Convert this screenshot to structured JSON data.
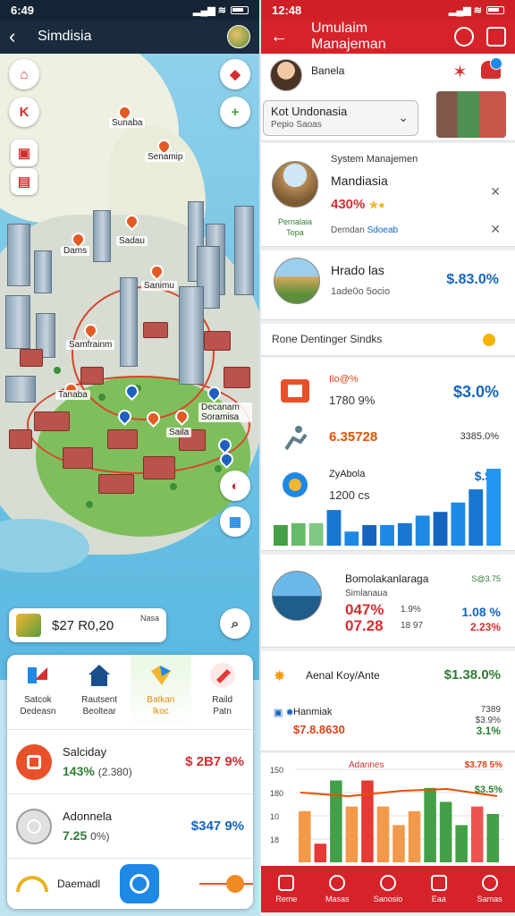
{
  "left": {
    "status_time": "6:49",
    "title": "Simdisia",
    "map_labels": [
      "Sunaba",
      "Senamip",
      "Sadau",
      "Dams",
      "Sanimu",
      "Samfrainm",
      "Tanaba",
      "Decanam Soramisa",
      "Saila"
    ],
    "price_chip": {
      "value": "$27 R0,20",
      "sub": "Nasa"
    },
    "quick": [
      {
        "label": "Satcok\nDedeasn"
      },
      {
        "label": "Rautsent\nBeoltear"
      },
      {
        "label": "Batkan\nlkoc"
      },
      {
        "label": "Raild\nPatn"
      }
    ],
    "stats": [
      {
        "name": "Salciday",
        "pct": "143%",
        "sub": "(2.380)",
        "value": "$ 2B7 9%"
      },
      {
        "name": "Adonnela",
        "pct": "7.25",
        "sub": "0%)",
        "value": "$347 9%"
      }
    ],
    "bottom_label": "Daemadl"
  },
  "right": {
    "status_time": "12:48",
    "title": "Umulaim Manajeman",
    "profile_name": "Banela",
    "select_main": "Kot Undonasia",
    "select_sub": "Pepio Saoas",
    "system": {
      "title": "System Manajemen",
      "name": "Mandiasia",
      "value": "430%",
      "caption": "Pernalaia\nTopa",
      "foot": "Demdan",
      "foot2": "Sdoeab"
    },
    "hrado": {
      "name": "Hrado las",
      "sub": "1ade0o 5ocio",
      "value": "$.83.0%"
    },
    "section_title": "Rone Dentinger Sindks",
    "stat_rows": [
      {
        "a": "Ilo@%",
        "b": "1780 9%",
        "value": "$3.0%"
      },
      {
        "big": "6.35728",
        "small": "3385.0%"
      },
      {
        "a": "ZyAbola",
        "b": "1200 cs",
        "value": "$.$3"
      }
    ],
    "bonia": {
      "name": "Bomolakanlaraga",
      "sub": "Simlanaua",
      "v1": "047%",
      "v2": "07.28",
      "s1": "1.9%",
      "s2": "18 97",
      "r0": "S@3.75",
      "r1": "1.08 %",
      "r2": "2.23%"
    },
    "annual": {
      "name": "Aenal Koy/Ante",
      "value": "$1.38.0%",
      "sub1": "Hanmiak",
      "sub2": "$7.8.8630",
      "r1": "7389\n$3.9%",
      "r2": "3.1%"
    },
    "tabs": [
      "Reme",
      "Masas",
      "Sanosio",
      "Eaa",
      "Samas"
    ]
  },
  "chart_data": {
    "type": "bar",
    "title": "Adannes",
    "ytick_labels": [
      "150",
      "180",
      "10",
      "18"
    ],
    "legend": [
      "$3.78 5%",
      "$3.5%"
    ],
    "series": [
      {
        "values": [
          55,
          20,
          88,
          60,
          88,
          60,
          40,
          55,
          80,
          65,
          40,
          60,
          52
        ]
      }
    ],
    "colors": [
      "#f2994a",
      "#e53935",
      "#43a047",
      "#f2994a",
      "#e53935",
      "#f2994a",
      "#f2994a",
      "#f2994a",
      "#43a047",
      "#43a047",
      "#43a047",
      "#ef5350",
      "#43a047"
    ]
  },
  "mini_chart": {
    "values": [
      22,
      24,
      24,
      38,
      15,
      22,
      22,
      24,
      32,
      36,
      46,
      60,
      82
    ],
    "colors": [
      "#43a047",
      "#66bb6a",
      "#81c784",
      "#1976d2",
      "#1e88e5",
      "#1565c0",
      "#1e88e5",
      "#1976d2",
      "#1e88e5",
      "#1565c0",
      "#1e88e5",
      "#1976d2",
      "#2196f3"
    ]
  }
}
